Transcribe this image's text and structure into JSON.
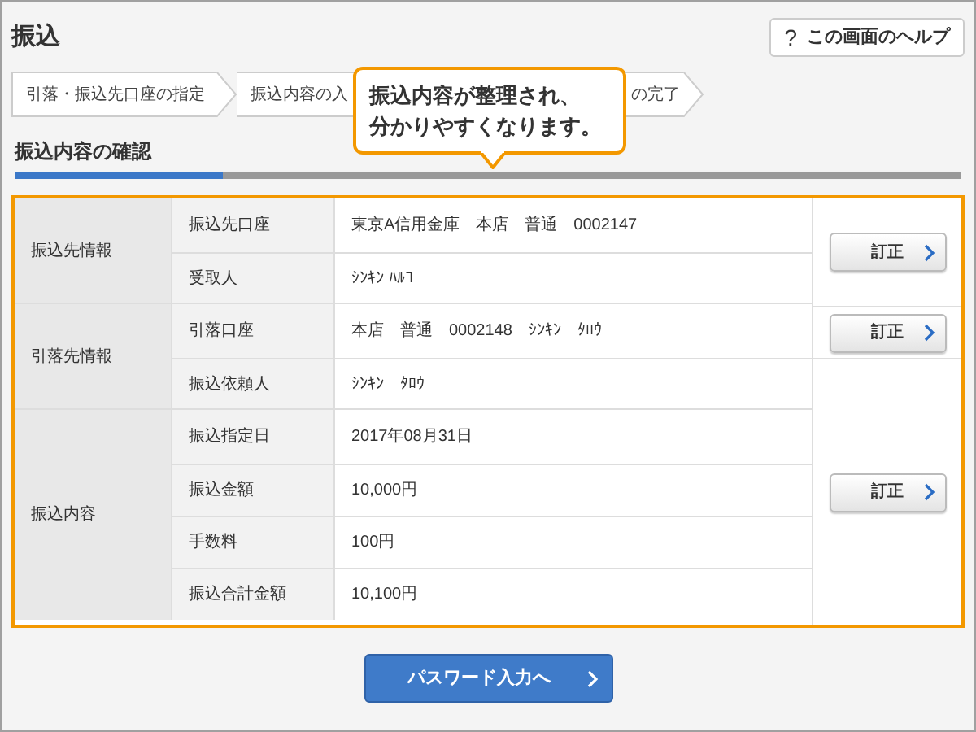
{
  "header": {
    "title": "振込",
    "help_button": "この画面のヘルプ",
    "help_mark": "?"
  },
  "steps": [
    {
      "label": "引落・振込先口座の指定"
    },
    {
      "label": "振込内容の入"
    },
    {
      "label": "の完了"
    }
  ],
  "callout": {
    "lines": [
      "振込内容が整理され、",
      "分かりやすくなります。"
    ]
  },
  "section": {
    "title": "振込内容の確認",
    "progress": {
      "level": 0.22
    }
  },
  "groups": [
    {
      "label": "振込先情報",
      "rows": [
        {
          "label": "振込先口座",
          "value": "東京A信用金庫　本店　普通　0002147",
          "correction": "訂正"
        },
        {
          "label": "受取人",
          "value": "ｼﾝｷﾝ ﾊﾙｺ"
        }
      ]
    },
    {
      "label": "引落先情報",
      "rows": [
        {
          "label": "引落口座",
          "value": "本店　普通　0002148　ｼﾝｷﾝ　ﾀﾛｳ",
          "correction": "訂正"
        },
        {
          "label": "振込依頼人",
          "value": "ｼﾝｷﾝ　ﾀﾛｳ",
          "correction": "訂正"
        }
      ]
    },
    {
      "label": "振込内容",
      "rows": [
        {
          "label": "振込指定日",
          "value": "2017年08月31日"
        },
        {
          "label": "振込金額",
          "value": "10,000円"
        },
        {
          "label": "手数料",
          "value": "100円"
        },
        {
          "label": "振込合計金額",
          "value": "10,100円"
        }
      ]
    }
  ],
  "submit_button": "パスワード入力へ"
}
